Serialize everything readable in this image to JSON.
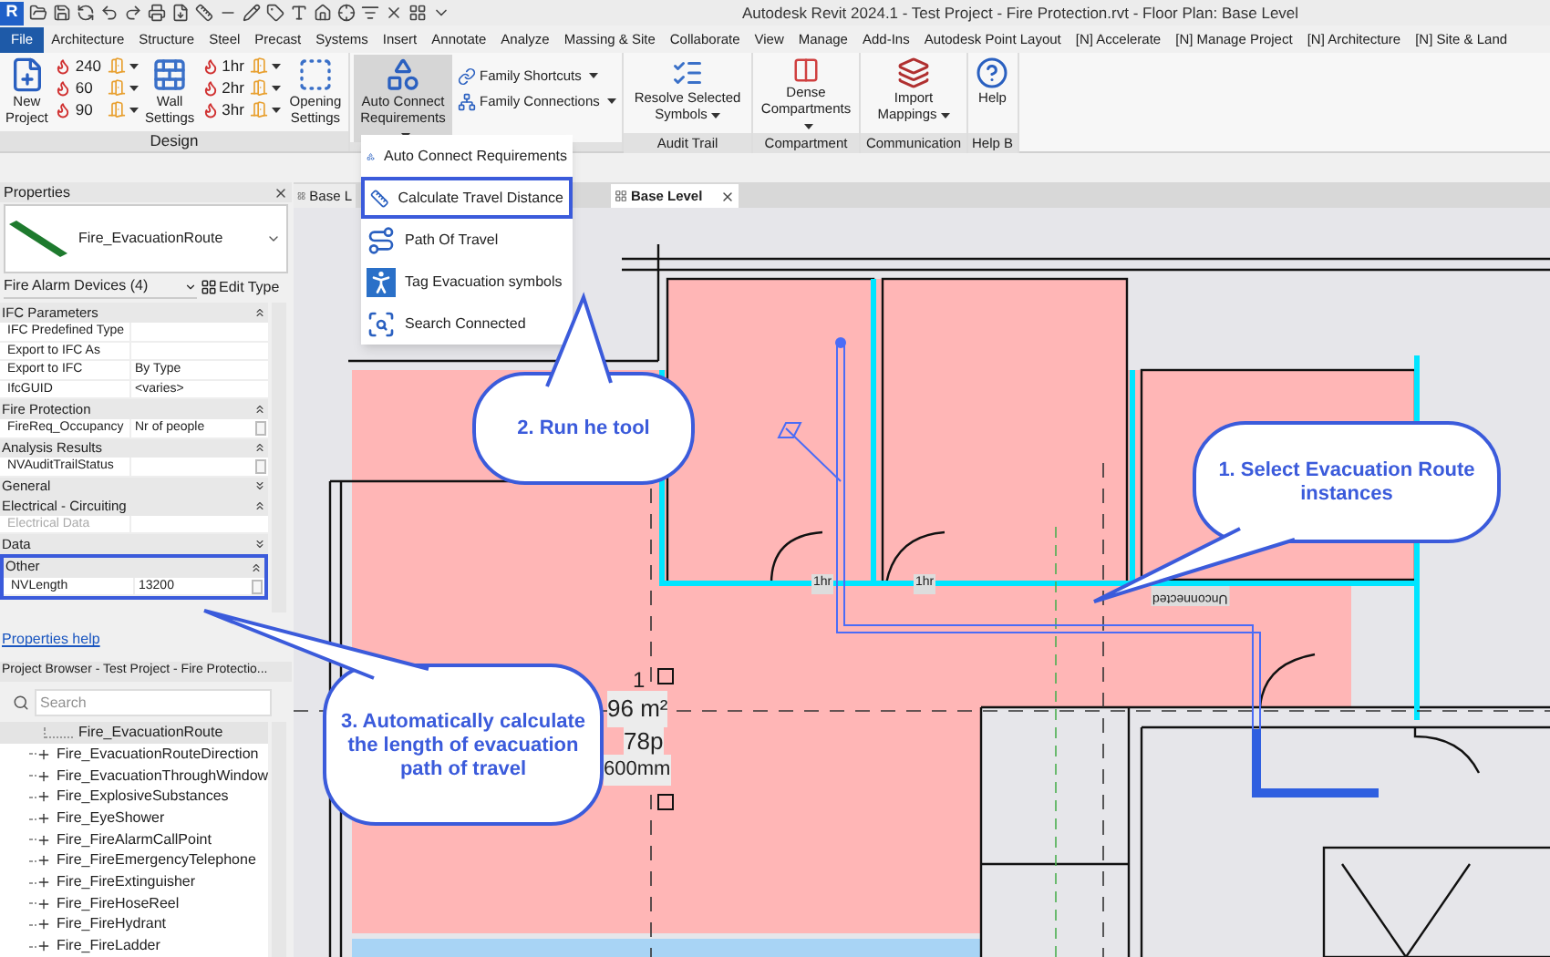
{
  "app_button": "R",
  "window": {
    "title": "Autodesk Revit 2024.1 - Test Project - Fire Protection.rvt - Floor Plan: Base Level"
  },
  "file_tab": "File",
  "tabs": [
    "Architecture",
    "Structure",
    "Steel",
    "Precast",
    "Systems",
    "Insert",
    "Annotate",
    "Analyze",
    "Massing & Site",
    "Collaborate",
    "View",
    "Manage",
    "Add-Ins",
    "Autodesk Point Layout",
    "[N] Accelerate",
    "[N] Manage Project",
    "[N] Architecture",
    "[N] Site & Land"
  ],
  "design_panel": {
    "label": "Design",
    "new_project": "New Project",
    "ratings_a": [
      "240",
      "60",
      "90"
    ],
    "wall_settings": "Wall Settings",
    "ratings_b": [
      "1hr",
      "2hr",
      "3hr"
    ],
    "opening_settings": "Opening Settings"
  },
  "connect_panel": {
    "auto_connect": {
      "label": "Auto Connect Requirements",
      "pressed": true
    },
    "shortcuts": [
      "Family Shortcuts",
      "Family Connections"
    ]
  },
  "panels": [
    {
      "label": "Audit Trail",
      "button": "Resolve Selected Symbols",
      "kind": "resolve",
      "dropdown": true
    },
    {
      "label": "Compartment",
      "button": "Dense Compartments",
      "kind": "compartment",
      "dropdown": true
    },
    {
      "label": "Communication",
      "button": "Import Mappings",
      "kind": "import",
      "dropdown": true
    },
    {
      "label": "Help B",
      "button": "Help",
      "kind": "help",
      "dropdown": false
    }
  ],
  "dropdown_menu": [
    {
      "label": "Auto Connect Requirements",
      "kind": "auto",
      "selected": false
    },
    {
      "label": "Calculate Travel Distance",
      "kind": "distance",
      "selected": true
    },
    {
      "label": "Path Of Travel",
      "kind": "path",
      "selected": false
    },
    {
      "label": "Tag Evacuation symbols",
      "kind": "tag",
      "selected": false
    },
    {
      "label": "Search Connected",
      "kind": "search",
      "selected": false
    }
  ],
  "properties": {
    "title": "Properties",
    "type_name": "Fire_EvacuationRoute",
    "filter": "Fire Alarm Devices (4)",
    "edit_type": "Edit Type",
    "groups": [
      {
        "name": "IFC Parameters",
        "expanded": true,
        "highlighted": false,
        "rows": [
          {
            "label": "IFC Predefined Type",
            "value": "",
            "kind": "text",
            "disabled": false
          },
          {
            "label": "Export to IFC As",
            "value": "",
            "kind": "text",
            "disabled": false
          },
          {
            "label": "Export to IFC",
            "value": "By Type",
            "kind": "text",
            "disabled": false
          },
          {
            "label": "IfcGUID",
            "value": "<varies>",
            "kind": "text",
            "disabled": false
          }
        ]
      },
      {
        "name": "Fire Protection",
        "expanded": true,
        "highlighted": false,
        "rows": [
          {
            "label": "FireReq_Occupancy",
            "value": "Nr of people",
            "kind": "box",
            "disabled": false
          }
        ]
      },
      {
        "name": "Analysis Results",
        "expanded": true,
        "highlighted": false,
        "rows": [
          {
            "label": "NVAuditTrailStatus",
            "value": "",
            "kind": "box",
            "disabled": false
          }
        ]
      },
      {
        "name": "General",
        "expanded": false,
        "highlighted": false
      },
      {
        "name": "Electrical - Circuiting",
        "expanded": true,
        "highlighted": false,
        "rows": [
          {
            "label": "Electrical Data",
            "value": "",
            "kind": "text",
            "disabled": true
          }
        ]
      },
      {
        "name": "Data",
        "expanded": false,
        "highlighted": false
      },
      {
        "name": "Other",
        "expanded": true,
        "highlighted": true,
        "rows": [
          {
            "label": "NVLength",
            "value": "13200",
            "kind": "box",
            "disabled": false
          }
        ]
      }
    ],
    "help_link": "Properties help"
  },
  "project_browser": {
    "title": "Project Browser - Test Project - Fire Protectio...",
    "search": {
      "placeholder": "Search"
    },
    "items": [
      {
        "label": "Fire_EvacuationRoute",
        "kind": "leaf",
        "selected": true
      },
      {
        "label": "Fire_EvacuationRouteDirection",
        "kind": "family",
        "selected": false
      },
      {
        "label": "Fire_EvacuationThroughWindow",
        "kind": "family",
        "selected": false
      },
      {
        "label": "Fire_ExplosiveSubstances",
        "kind": "family",
        "selected": false
      },
      {
        "label": "Fire_EyeShower",
        "kind": "family",
        "selected": false
      },
      {
        "label": "Fire_FireAlarmCallPoint",
        "kind": "family",
        "selected": false
      },
      {
        "label": "Fire_FireEmergencyTelephone",
        "kind": "family",
        "selected": false
      },
      {
        "label": "Fire_FireExtinguisher",
        "kind": "family",
        "selected": false
      },
      {
        "label": "Fire_FireHoseReel",
        "kind": "family",
        "selected": false
      },
      {
        "label": "Fire_FireHydrant",
        "kind": "family",
        "selected": false
      },
      {
        "label": "Fire_FireLadder",
        "kind": "family",
        "selected": false
      }
    ]
  },
  "view_tabs": [
    {
      "label": "Base L",
      "selected": false,
      "closable": false
    },
    {
      "label": "Base Level",
      "selected": true,
      "closable": true
    }
  ],
  "plan": {
    "wall_ratings": [
      "1hr",
      "1hr"
    ],
    "wall_note": "Unconnected",
    "room_tag": {
      "number": "1",
      "area": "96 m²",
      "occupancy": "78p",
      "height": "600mm"
    }
  },
  "callouts": [
    "1. Select Evacuation Route instances",
    "2. Run he tool",
    "3. Automatically calculate the length of evacuation path of travel"
  ]
}
